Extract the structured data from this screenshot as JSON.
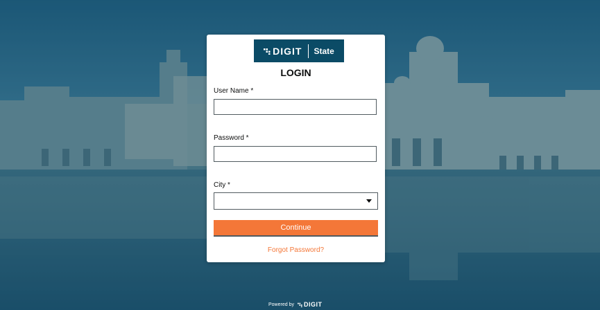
{
  "colors": {
    "accent": "#f47738",
    "brand": "#0b4b66",
    "overlay": "#2a5a72",
    "text": "#0b0c0c",
    "border": "#505a5f"
  },
  "logo": {
    "brand_text": "DIGIT",
    "state_text": "State"
  },
  "login": {
    "title": "LOGIN",
    "username": {
      "label": "User Name *",
      "value": ""
    },
    "password": {
      "label": "Password *",
      "value": ""
    },
    "city": {
      "label": "City *",
      "value": "",
      "icon": "caret-down-icon"
    },
    "continue_label": "Continue",
    "forgot_label": "Forgot Password?"
  },
  "footer": {
    "powered_by": "Powered by",
    "brand_text": "DIGIT"
  }
}
